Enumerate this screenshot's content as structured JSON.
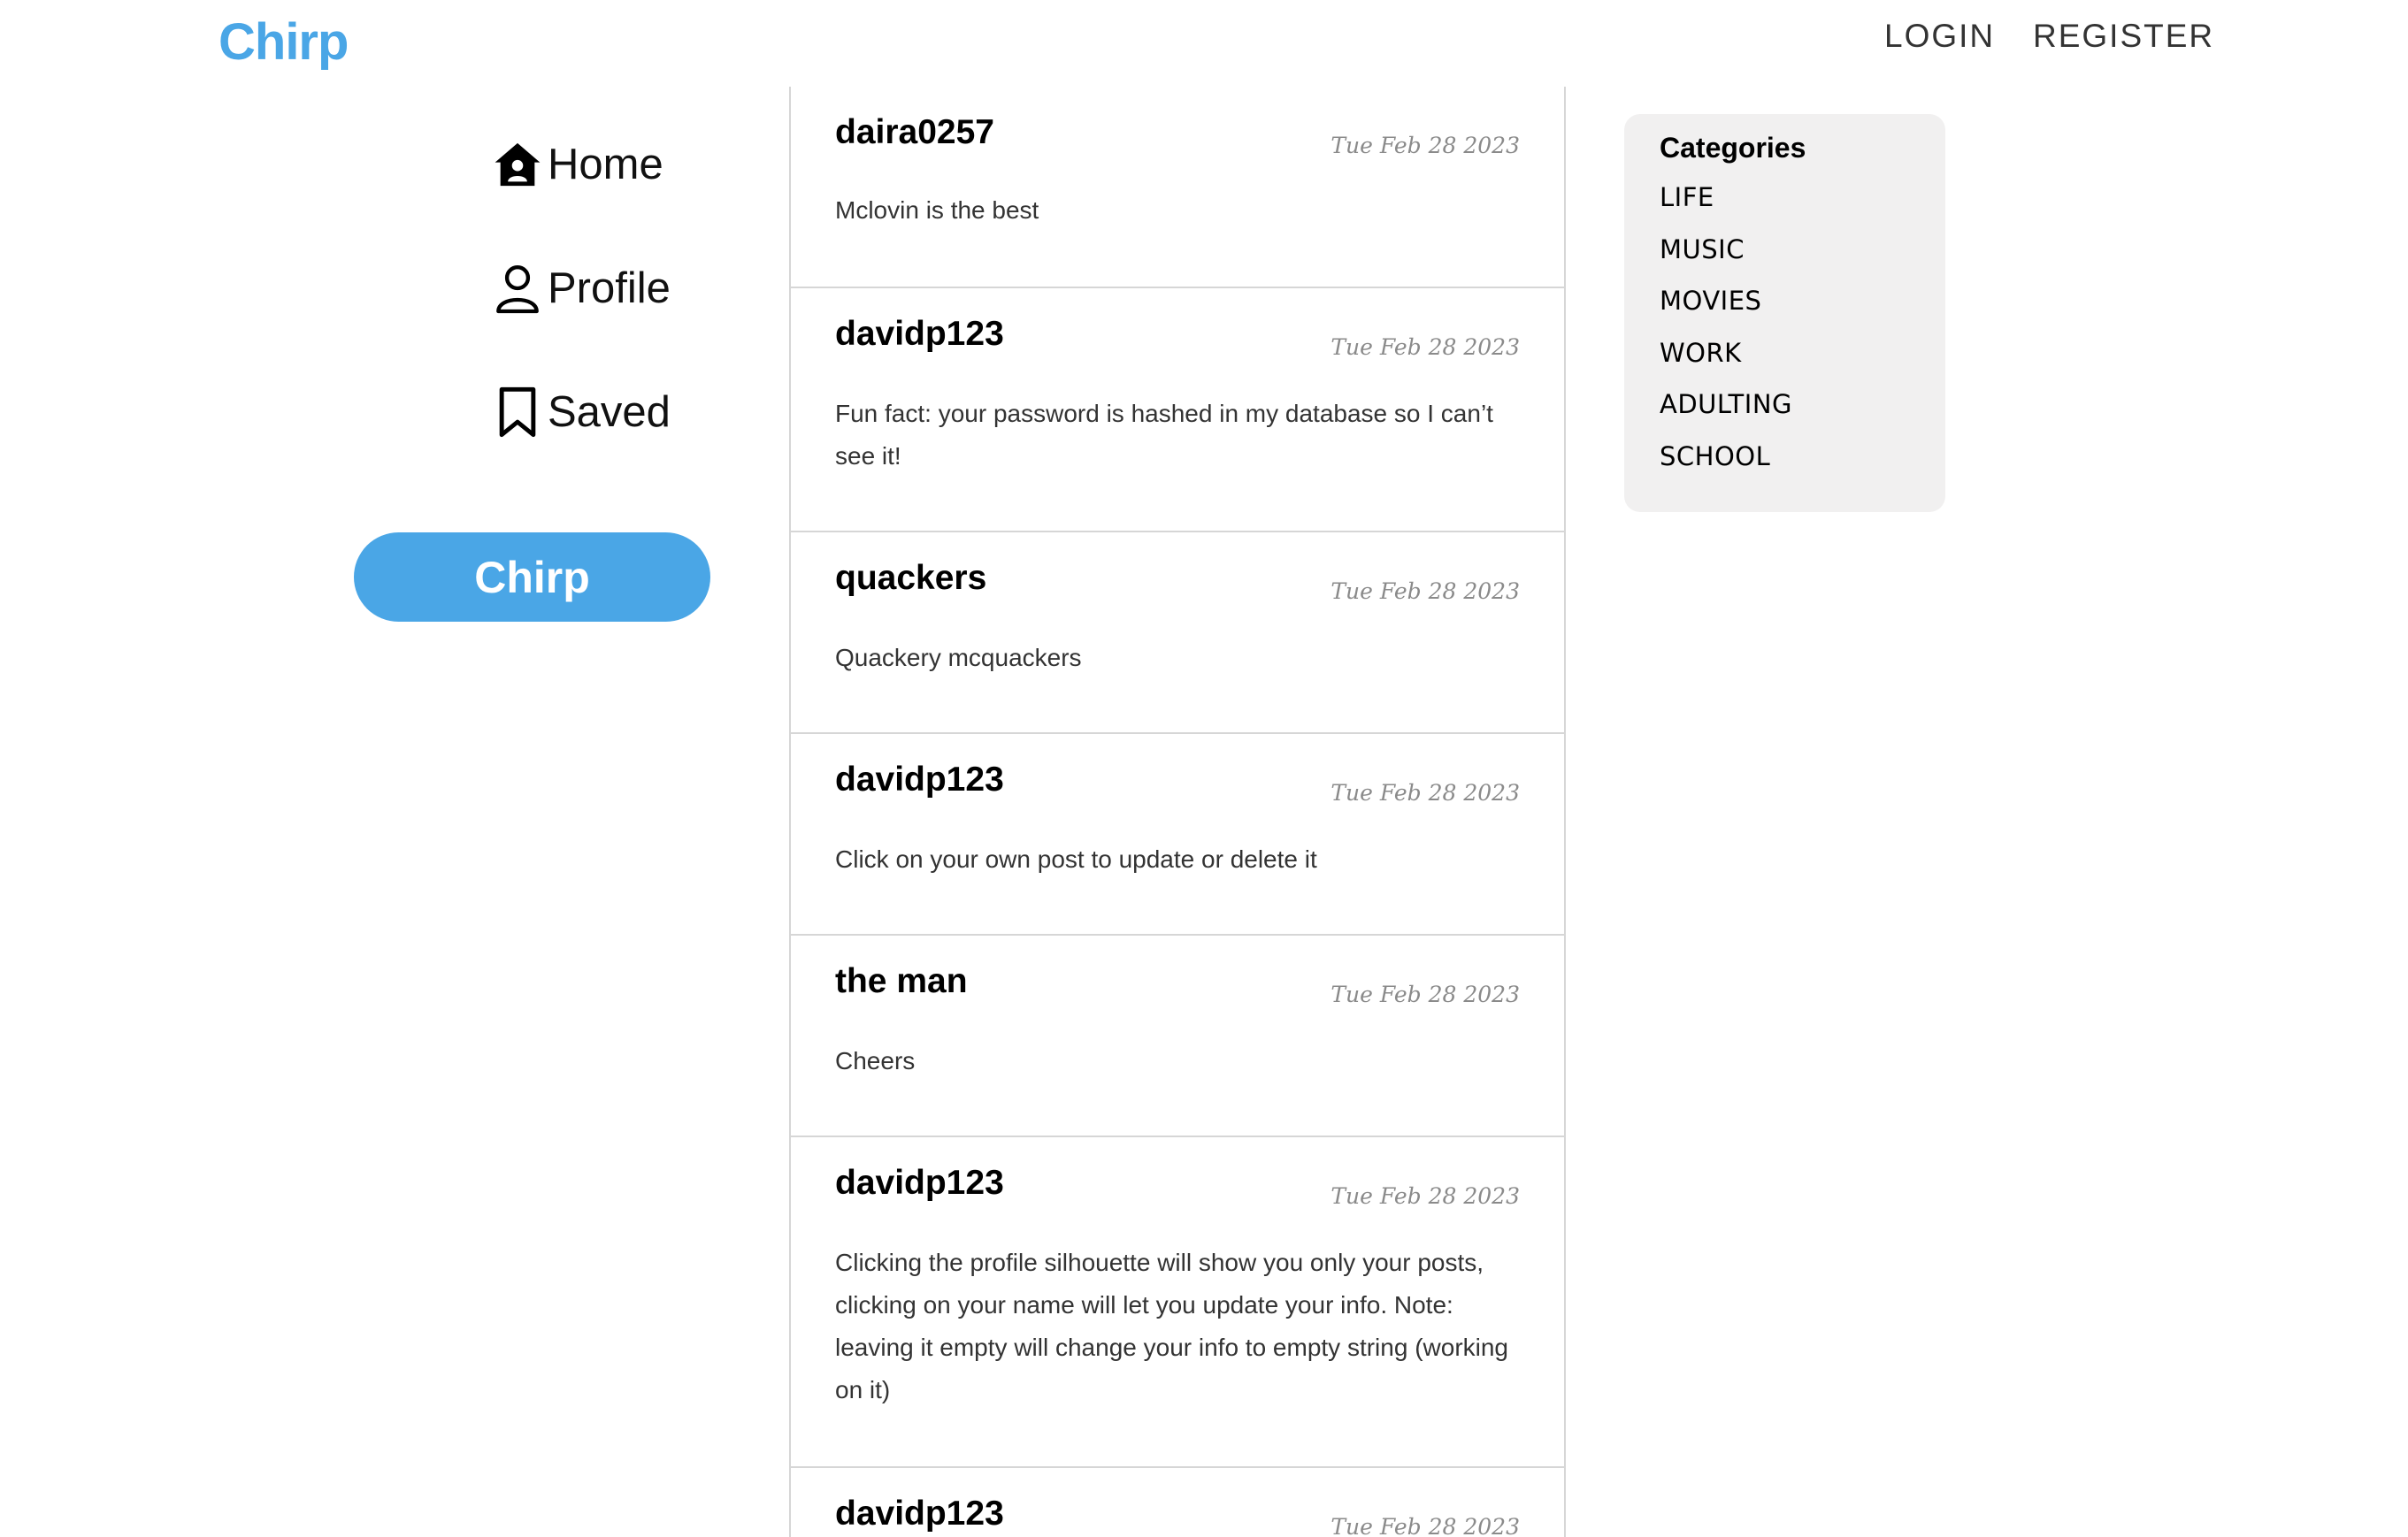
{
  "header": {
    "logo": "Chirp",
    "login": "LOGIN",
    "register": "REGISTER"
  },
  "sidebar": {
    "items": [
      {
        "label": "Home",
        "icon": "home-icon"
      },
      {
        "label": "Profile",
        "icon": "user-icon"
      },
      {
        "label": "Saved",
        "icon": "bookmark-icon"
      }
    ],
    "chirp_button": "Chirp"
  },
  "posts": [
    {
      "author": "daira0257",
      "date": "Tue Feb 28 2023",
      "body": "Mclovin is the best"
    },
    {
      "author": "davidp123",
      "date": "Tue Feb 28 2023",
      "body": "Fun fact: your password is hashed in my database so I can’t see it!"
    },
    {
      "author": "quackers",
      "date": "Tue Feb 28 2023",
      "body": "Quackery mcquackers"
    },
    {
      "author": "davidp123",
      "date": "Tue Feb 28 2023",
      "body": "Click on your own post to update or delete it"
    },
    {
      "author": "the man",
      "date": "Tue Feb 28 2023",
      "body": "Cheers"
    },
    {
      "author": "davidp123",
      "date": "Tue Feb 28 2023",
      "body": "Clicking the profile silhouette will show you only your posts, clicking on your name will let you update your info. Note: leaving it empty will change your info to empty string (working on it)"
    },
    {
      "author": "davidp123",
      "date": "Tue Feb 28 2023",
      "body": ""
    }
  ],
  "categories": {
    "title": "Categories",
    "items": [
      "LIFE",
      "MUSIC",
      "MOVIES",
      "WORK",
      "ADULTING",
      "SCHOOL"
    ]
  },
  "colors": {
    "brand": "#4aa6e6",
    "divider": "#d6d6d6",
    "category_bg": "#f1f0f0"
  }
}
